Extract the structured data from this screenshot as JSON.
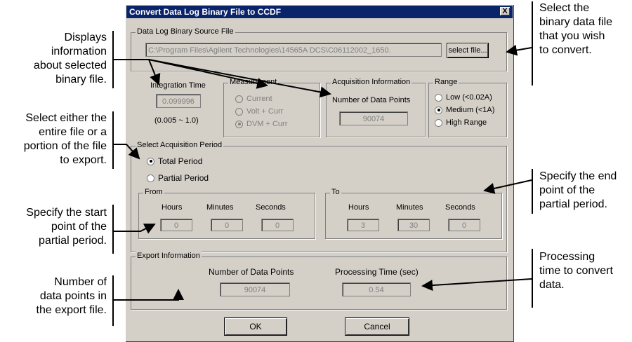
{
  "dialog": {
    "title": "Convert Data Log Binary File to CCDF",
    "close_glyph": "X"
  },
  "source": {
    "legend": "Data Log Binary Source File",
    "path": "C:\\Program Files\\Agilent Technologies\\14565A DCS\\C06112002_1650.",
    "select_button": "select file..."
  },
  "integration": {
    "label": "Integration Time",
    "value": "0.099996",
    "range": "(0.005 ~ 1.0)"
  },
  "measurement": {
    "legend": "Measurement",
    "options": [
      "Current",
      "Volt + Curr",
      "DVM + Curr"
    ],
    "selected": "DVM + Curr"
  },
  "acquisition_info": {
    "legend": "Acquisition Information",
    "points_label": "Number of Data Points",
    "points_value": "90074"
  },
  "range": {
    "legend": "Range",
    "options": [
      "Low (<0.02A)",
      "Medium (<1A)",
      "High Range"
    ],
    "selected": "Medium (<1A)"
  },
  "period": {
    "legend": "Select Acquisition Period",
    "total": "Total Period",
    "partial": "Partial Period",
    "selected": "Total Period",
    "from": {
      "legend": "From",
      "hours_label": "Hours",
      "minutes_label": "Minutes",
      "seconds_label": "Seconds",
      "hours": "0",
      "minutes": "0",
      "seconds": "0"
    },
    "to": {
      "legend": "To",
      "hours_label": "Hours",
      "minutes_label": "Minutes",
      "seconds_label": "Seconds",
      "hours": "3",
      "minutes": "30",
      "seconds": "0"
    }
  },
  "export": {
    "legend": "Export Information",
    "points_label": "Number of Data Points",
    "points_value": "90074",
    "time_label": "Processing Time (sec)",
    "time_value": "0.54"
  },
  "buttons": {
    "ok": "OK",
    "cancel": "Cancel"
  },
  "annotations": {
    "displays": [
      "Displays",
      "information",
      "about selected",
      "binary file."
    ],
    "select_file": [
      "Select the",
      "binary data file",
      "that you wish",
      "to convert."
    ],
    "select_either": [
      "Select either the",
      "entire file or a",
      "portion of the file",
      "to export."
    ],
    "end_point": [
      "Specify the end",
      "point of the",
      "partial period."
    ],
    "start_point": [
      "Specify the start",
      "point of the",
      "partial period."
    ],
    "processing": [
      "Processing",
      "time to convert",
      "data."
    ],
    "num_points": [
      "Number of",
      "data points in",
      "the export file."
    ]
  }
}
